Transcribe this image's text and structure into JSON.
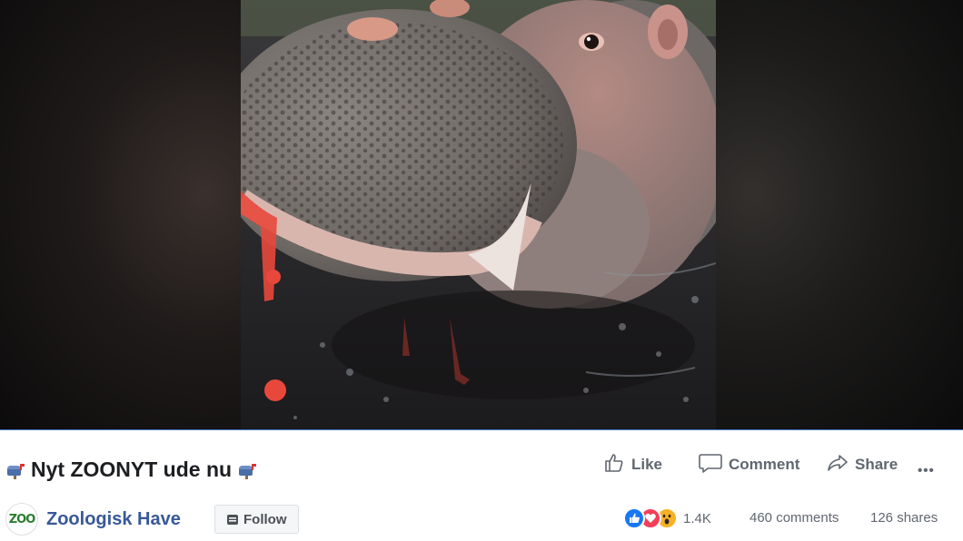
{
  "post": {
    "title": "Nyt ZOONYT ude nu",
    "title_icons": [
      "mailbox-icon",
      "mailbox-icon"
    ]
  },
  "page": {
    "avatar_text": "ZOO",
    "name": "Zoologisk Have",
    "follow_label": "Follow"
  },
  "actions": {
    "like_label": "Like",
    "comment_label": "Comment",
    "share_label": "Share",
    "more_label": "•••"
  },
  "stats": {
    "reactions_count": "1.4K",
    "reaction_types": [
      "like",
      "love",
      "wow"
    ],
    "comments": "460 comments",
    "shares": "126 shares"
  },
  "colors": {
    "page_link": "#385898",
    "action_text": "#606770",
    "video_border": "#4a76c9",
    "like_blue": "#1877f2",
    "love_red": "#f33e58",
    "wow_yellow": "#f7b125"
  }
}
